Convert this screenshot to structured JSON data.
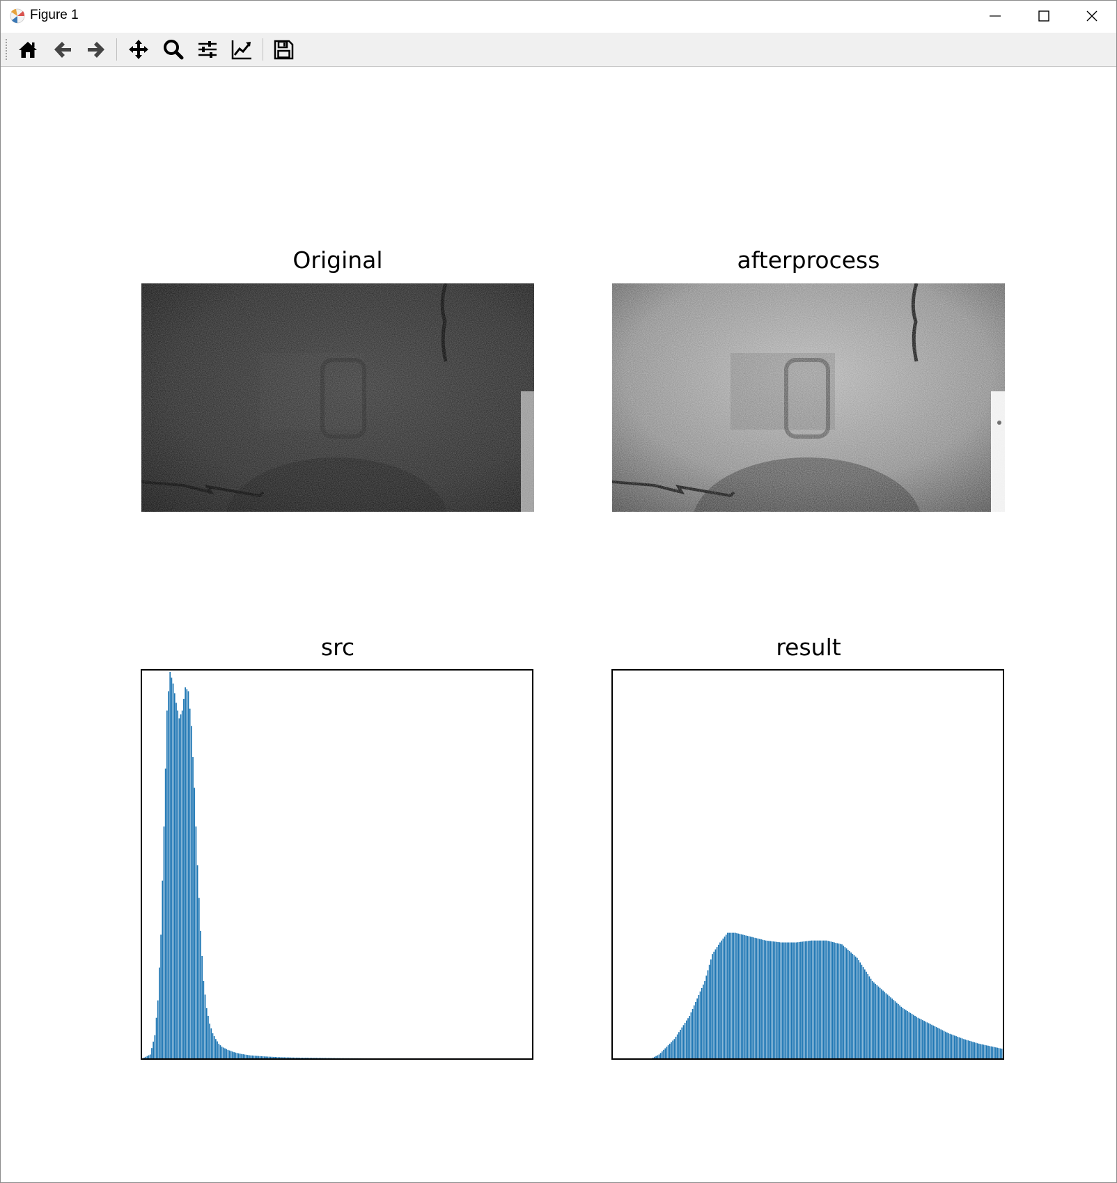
{
  "window": {
    "title": "Figure 1",
    "controls": [
      "minimize-icon",
      "maximize-icon",
      "close-icon"
    ]
  },
  "toolbar": {
    "buttons": [
      {
        "name": "home",
        "icon": "home-icon"
      },
      {
        "name": "back",
        "icon": "arrow-left-icon"
      },
      {
        "name": "forward",
        "icon": "arrow-right-icon"
      },
      {
        "name": "pan",
        "icon": "move-icon"
      },
      {
        "name": "zoom",
        "icon": "magnifier-icon"
      },
      {
        "name": "configure-subplots",
        "icon": "sliders-icon"
      },
      {
        "name": "edit-axes",
        "icon": "line-chart-icon"
      },
      {
        "name": "save",
        "icon": "floppy-disk-icon"
      }
    ]
  },
  "figure": {
    "panels": {
      "original": {
        "title": "Original"
      },
      "afterprocess": {
        "title": "afterprocess"
      },
      "src": {
        "title": "src"
      },
      "result": {
        "title": "result"
      }
    },
    "bar_color": "#1f77b4"
  },
  "chart_data": [
    {
      "type": "bar",
      "title": "src",
      "axis": "off",
      "x_range": [
        0,
        255
      ],
      "y_range_relative": [
        0,
        1
      ],
      "x": [
        0,
        5,
        8,
        10,
        12,
        14,
        16,
        18,
        20,
        22,
        24,
        26,
        28,
        30,
        32,
        34,
        36,
        38,
        40,
        42,
        44,
        46,
        48,
        50,
        52,
        56,
        60,
        64,
        70,
        80,
        90,
        100,
        110,
        120,
        130,
        140,
        150,
        255
      ],
      "values": [
        0,
        0.01,
        0.06,
        0.15,
        0.32,
        0.6,
        0.9,
        1.0,
        0.97,
        0.92,
        0.88,
        0.9,
        0.96,
        0.95,
        0.86,
        0.7,
        0.5,
        0.33,
        0.2,
        0.13,
        0.09,
        0.065,
        0.05,
        0.038,
        0.03,
        0.022,
        0.016,
        0.012,
        0.008,
        0.005,
        0.003,
        0.002,
        0.0015,
        0.001,
        0.0005,
        0.0003,
        0.0001,
        0
      ]
    },
    {
      "type": "bar",
      "title": "result",
      "axis": "off",
      "x_range": [
        0,
        255
      ],
      "y_range_relative": [
        0,
        1
      ],
      "x": [
        0,
        25,
        30,
        40,
        50,
        60,
        65,
        70,
        75,
        80,
        85,
        90,
        100,
        110,
        120,
        130,
        140,
        150,
        160,
        170,
        180,
        190,
        200,
        210,
        220,
        230,
        240,
        255
      ],
      "values": [
        0,
        0,
        0.01,
        0.05,
        0.11,
        0.2,
        0.27,
        0.3,
        0.325,
        0.325,
        0.32,
        0.315,
        0.305,
        0.3,
        0.3,
        0.305,
        0.305,
        0.295,
        0.26,
        0.2,
        0.165,
        0.13,
        0.105,
        0.085,
        0.065,
        0.05,
        0.038,
        0.025
      ]
    }
  ]
}
